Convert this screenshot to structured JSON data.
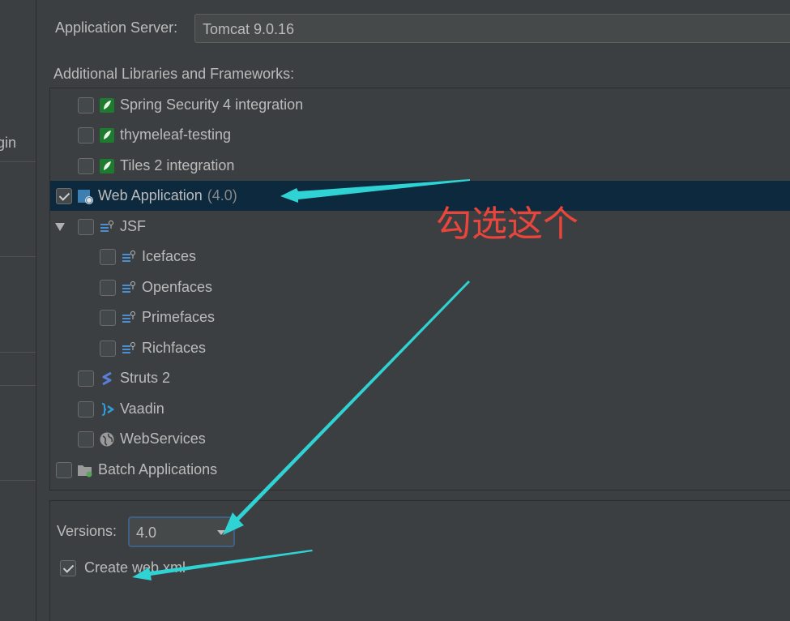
{
  "sidebar": {
    "partial_text": "gin"
  },
  "server": {
    "label": "Application Server:",
    "value": "Tomcat 9.0.16"
  },
  "libraries_label": "Additional Libraries and Frameworks:",
  "tree": {
    "spring_security": "Spring Security 4 integration",
    "thymeleaf_testing": "thymeleaf-testing",
    "tiles": "Tiles 2 integration",
    "web_app": "Web Application",
    "web_app_version": "(4.0)",
    "jsf": "JSF",
    "icefaces": "Icefaces",
    "openfaces": "Openfaces",
    "primefaces": "Primefaces",
    "richfaces": "Richfaces",
    "struts": "Struts 2",
    "vaadin": "Vaadin",
    "webservices": "WebServices",
    "batch": "Batch Applications"
  },
  "versions": {
    "label": "Versions:",
    "value": "4.0"
  },
  "create_web_xml": "Create web.xml",
  "annotation": "勾选这个",
  "colors": {
    "arrow": "#2fd3d3",
    "annotation": "#e8453c",
    "selection": "#0d293e"
  }
}
